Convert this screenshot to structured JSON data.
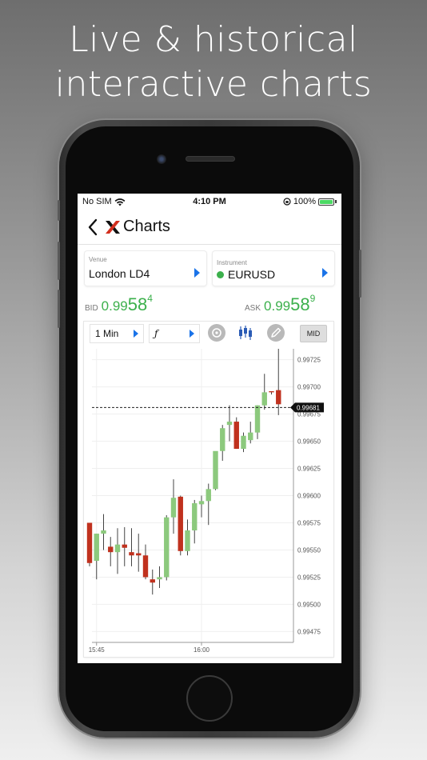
{
  "headline": {
    "line1": "Live & historical",
    "line2": "interactive charts"
  },
  "status_bar": {
    "carrier": "No SIM",
    "time": "4:10 PM",
    "battery": "100%"
  },
  "nav": {
    "title": "Charts"
  },
  "venue": {
    "label": "Venue",
    "value": "London LD4"
  },
  "instrument": {
    "label": "Instrument",
    "value": "EURUSD",
    "status_color": "#3cb04c"
  },
  "bid": {
    "label": "BID",
    "prefix": "0.99",
    "big": "58",
    "sup": "4"
  },
  "ask": {
    "label": "ASK",
    "prefix": "0.99",
    "big": "58",
    "sup": "9"
  },
  "toolbar": {
    "interval": "1 Min",
    "function": "ƒ",
    "mid_label": "MID"
  },
  "colors": {
    "up": "#8cc97d",
    "down": "#c0311e",
    "price_green": "#3cb04c",
    "accent": "#1a73e8"
  },
  "chart_data": {
    "type": "candlestick",
    "ylim": [
      0.99465,
      0.99735
    ],
    "y_ticks": [
      0.99725,
      0.997,
      0.99675,
      0.9965,
      0.99625,
      0.996,
      0.99575,
      0.9955,
      0.99525,
      0.995,
      0.99475
    ],
    "y_tick_labels": [
      "0.99725",
      "0.99700",
      "0.99675",
      "0.99650",
      "0.99625",
      "0.99600",
      "0.99575",
      "0.99550",
      "0.99525",
      "0.99500",
      "0.99475"
    ],
    "x_tick_labels": [
      {
        "label": "15:45",
        "index": 1
      },
      {
        "label": "16:00",
        "index": 16
      }
    ],
    "current_price": 0.99681,
    "current_price_label": "0.99681",
    "candles": [
      {
        "o": 0.99575,
        "h": 0.99575,
        "l": 0.99535,
        "c": 0.99538
      },
      {
        "o": 0.9954,
        "h": 0.99565,
        "l": 0.99523,
        "c": 0.99565
      },
      {
        "o": 0.99565,
        "h": 0.99583,
        "l": 0.9955,
        "c": 0.99568
      },
      {
        "o": 0.99553,
        "h": 0.99562,
        "l": 0.99535,
        "c": 0.99548
      },
      {
        "o": 0.99548,
        "h": 0.9957,
        "l": 0.99528,
        "c": 0.99555
      },
      {
        "o": 0.99555,
        "h": 0.99571,
        "l": 0.99535,
        "c": 0.99552
      },
      {
        "o": 0.99548,
        "h": 0.9957,
        "l": 0.99535,
        "c": 0.99545
      },
      {
        "o": 0.99547,
        "h": 0.99565,
        "l": 0.9953,
        "c": 0.99545
      },
      {
        "o": 0.99545,
        "h": 0.99555,
        "l": 0.99523,
        "c": 0.99525
      },
      {
        "o": 0.99523,
        "h": 0.99532,
        "l": 0.99509,
        "c": 0.9952
      },
      {
        "o": 0.99523,
        "h": 0.99535,
        "l": 0.99515,
        "c": 0.99525
      },
      {
        "o": 0.99525,
        "h": 0.99582,
        "l": 0.99522,
        "c": 0.9958
      },
      {
        "o": 0.9958,
        "h": 0.99615,
        "l": 0.99565,
        "c": 0.99598
      },
      {
        "o": 0.99599,
        "h": 0.996,
        "l": 0.99545,
        "c": 0.99549
      },
      {
        "o": 0.99549,
        "h": 0.99578,
        "l": 0.99545,
        "c": 0.99568
      },
      {
        "o": 0.99568,
        "h": 0.99596,
        "l": 0.99556,
        "c": 0.99593
      },
      {
        "o": 0.99592,
        "h": 0.996,
        "l": 0.9958,
        "c": 0.99595
      },
      {
        "o": 0.99595,
        "h": 0.99611,
        "l": 0.99573,
        "c": 0.99606
      },
      {
        "o": 0.99606,
        "h": 0.99637,
        "l": 0.99605,
        "c": 0.99641
      },
      {
        "o": 0.99641,
        "h": 0.99665,
        "l": 0.99632,
        "c": 0.99662
      },
      {
        "o": 0.99665,
        "h": 0.99683,
        "l": 0.9965,
        "c": 0.99668
      },
      {
        "o": 0.99668,
        "h": 0.99672,
        "l": 0.99643,
        "c": 0.99643
      },
      {
        "o": 0.99643,
        "h": 0.99658,
        "l": 0.9964,
        "c": 0.99655
      },
      {
        "o": 0.99651,
        "h": 0.99668,
        "l": 0.99648,
        "c": 0.99658
      },
      {
        "o": 0.99658,
        "h": 0.99683,
        "l": 0.99652,
        "c": 0.99683
      },
      {
        "o": 0.99683,
        "h": 0.99712,
        "l": 0.99679,
        "c": 0.99695
      },
      {
        "o": 0.99696,
        "h": 0.99696,
        "l": 0.99693,
        "c": 0.99695
      },
      {
        "o": 0.99697,
        "h": 0.99735,
        "l": 0.99674,
        "c": 0.99684
      }
    ]
  }
}
